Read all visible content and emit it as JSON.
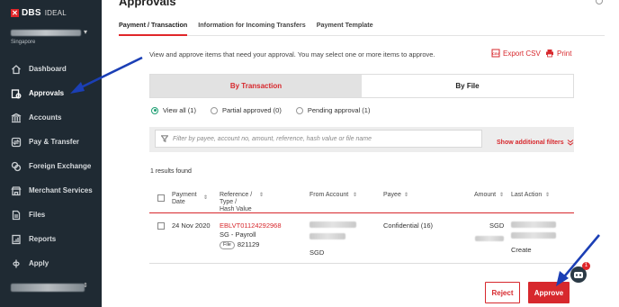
{
  "brand": {
    "logo_mark": "✕",
    "name": "DBS",
    "product": "IDEAL"
  },
  "account": {
    "region": "Singapore"
  },
  "sidebar": {
    "items": [
      {
        "label": "Dashboard",
        "icon": "home-icon"
      },
      {
        "label": "Approvals",
        "icon": "approvals-icon",
        "active": true
      },
      {
        "label": "Accounts",
        "icon": "bank-icon"
      },
      {
        "label": "Pay & Transfer",
        "icon": "transfer-icon"
      },
      {
        "label": "Foreign Exchange",
        "icon": "fx-icon"
      },
      {
        "label": "Merchant Services",
        "icon": "merchant-icon"
      },
      {
        "label": "Files",
        "icon": "files-icon"
      },
      {
        "label": "Reports",
        "icon": "reports-icon"
      },
      {
        "label": "Apply",
        "icon": "apply-icon"
      }
    ]
  },
  "page": {
    "title": "Approvals",
    "tabs": [
      {
        "label": "Payment / Transaction",
        "active": true
      },
      {
        "label": "Information for Incoming Transfers"
      },
      {
        "label": "Payment Template"
      }
    ],
    "intro": "View and approve items that need your approval. You may select one or more items to approve.",
    "export_label": "Export CSV",
    "print_label": "Print"
  },
  "mode_toggle": {
    "by_transaction": "By Transaction",
    "by_file": "By File"
  },
  "filters": {
    "radios": [
      {
        "label": "View all (1)",
        "selected": true
      },
      {
        "label": "Partial approved (0)"
      },
      {
        "label": "Pending approval (1)"
      }
    ],
    "search_placeholder": "Filter by payee, account no, amount, reference, hash value or file name",
    "more_label": "Show additional filters"
  },
  "results": {
    "label": "1 results found"
  },
  "table": {
    "headers": {
      "payment_date": "Payment\nDate",
      "reference": "Reference /\nType /\nHash Value",
      "from_account": "From Account",
      "payee": "Payee",
      "amount": "Amount",
      "last_action": "Last Action"
    },
    "rows": [
      {
        "payment_date": "24 Nov 2020",
        "reference": "EBLVT01124292968",
        "type": "SG - Payroll",
        "file_tag": "File",
        "hash_value": "821129",
        "from_account_currency": "SGD",
        "payee": "Confidential (16)",
        "amount_currency": "SGD",
        "last_action": "Create"
      }
    ]
  },
  "actions": {
    "reject_label": "Reject",
    "approve_label": "Approve",
    "bot_badge": "1"
  },
  "colors": {
    "brand_red": "#d7282d",
    "sidebar_bg": "#1f2a33",
    "annotation_blue": "#1b3fb5",
    "radio_green": "#1e9f73"
  }
}
